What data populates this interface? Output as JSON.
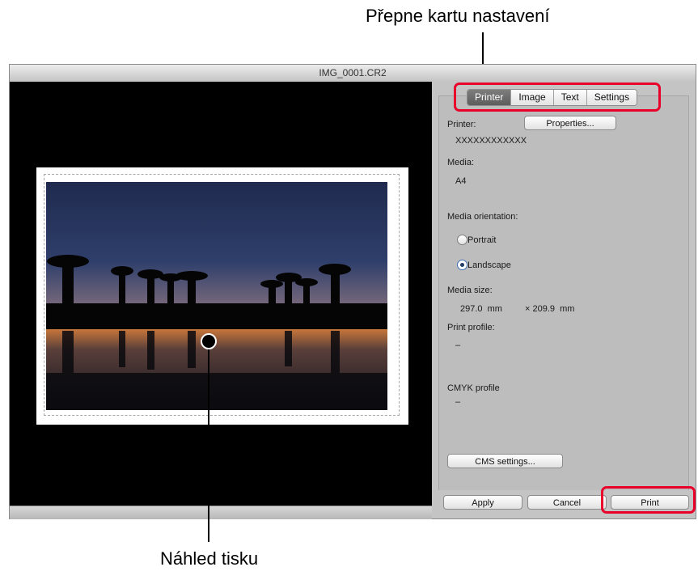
{
  "callouts": {
    "top": "Přepne kartu nastavení",
    "bottom": "Náhled tisku"
  },
  "window": {
    "title": "IMG_0001.CR2"
  },
  "tabs": [
    {
      "label": "Printer",
      "active": true
    },
    {
      "label": "Image",
      "active": false
    },
    {
      "label": "Text",
      "active": false
    },
    {
      "label": "Settings",
      "active": false
    }
  ],
  "printer": {
    "label": "Printer:",
    "properties_button": "Properties...",
    "name": "XXXXXXXXXXXX",
    "media_label": "Media:",
    "media_value": "A4",
    "orientation_label": "Media orientation:",
    "portrait_label": "Portrait",
    "landscape_label": "Landscape",
    "orientation_selected": "Landscape",
    "media_size_label": "Media size:",
    "media_width": "297.0  mm",
    "media_height": "× 209.9  mm",
    "print_profile_label": "Print profile:",
    "print_profile_value": "–",
    "cmyk_profile_label": "CMYK profile",
    "cmyk_profile_value": "–",
    "cms_settings_button": "CMS settings..."
  },
  "actions": {
    "apply": "Apply",
    "cancel": "Cancel",
    "print": "Print"
  },
  "colors": {
    "highlight": "#e8002a",
    "preview_background": "#000000",
    "active_tab": "#6a6a6a"
  }
}
